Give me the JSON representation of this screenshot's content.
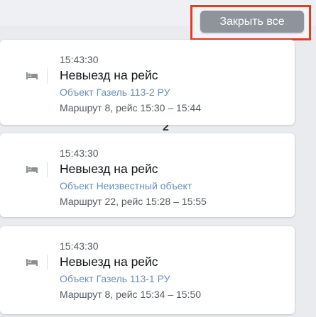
{
  "header": {
    "close_all_label": "Закрыть все"
  },
  "notifications": [
    {
      "time": "15:43:30",
      "title": "Невыезд на рейс",
      "object": "Объект Газель 113-2 РУ",
      "route": "Маршрут 8, рейс 15:30 – 15:44"
    },
    {
      "time": "15:43:30",
      "title": "Невыезд на рейс",
      "object": "Объект Неизвестный объект",
      "route": "Маршрут 22, рейс 15:28 – 15:55"
    },
    {
      "time": "15:43:30",
      "title": "Невыезд на рейс",
      "object": "Объект Газель 113-1 РУ",
      "route": "Маршрут 8, рейс 15:34 – 15:50"
    }
  ],
  "background": {
    "partial_text": "2"
  },
  "icons": {
    "notification_icon": "bed-icon"
  },
  "colors": {
    "highlight_border": "#e53b22",
    "button_bg": "#8f939b",
    "object_link": "#6b8fb9"
  }
}
